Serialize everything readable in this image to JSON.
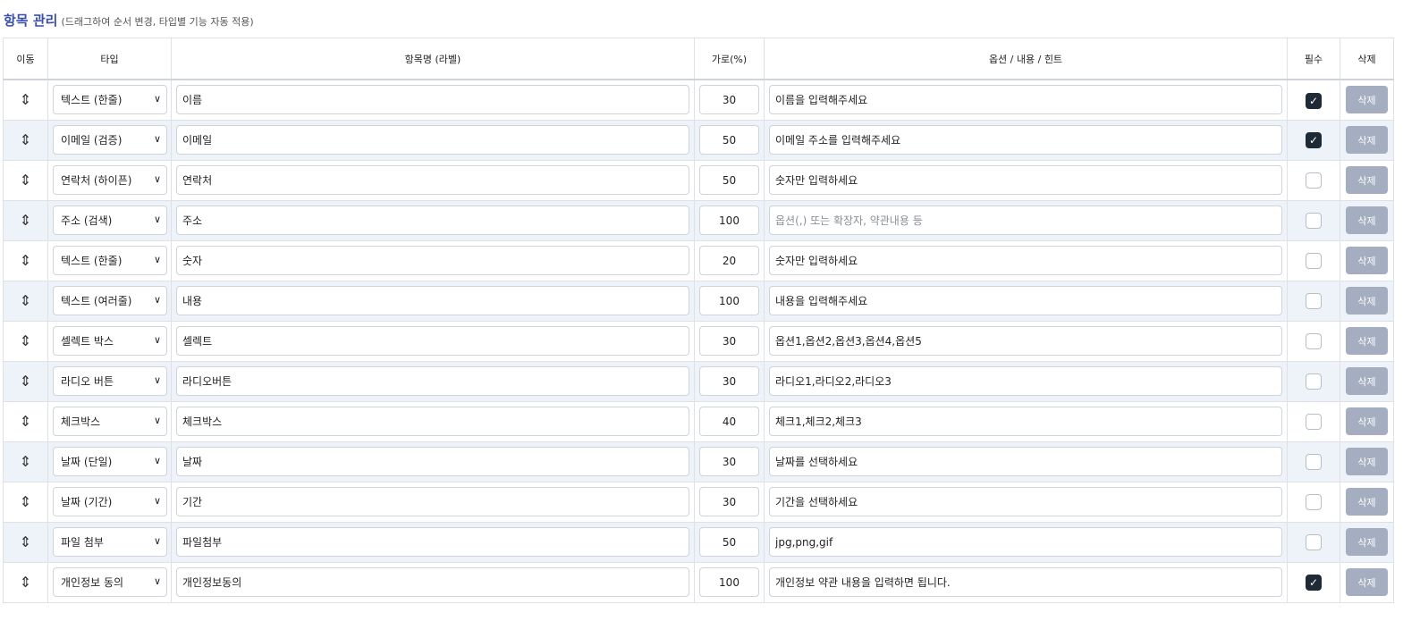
{
  "section": {
    "title": "항목 관리",
    "hint": "(드래그하여 순서 변경, 타입별 기능 자동 적용)"
  },
  "columns": {
    "move": "이동",
    "type": "타입",
    "label": "항목명 (라벨)",
    "width": "가로(%)",
    "options": "옵션 / 내용 / 힌트",
    "required": "필수",
    "delete": "삭제"
  },
  "icons": {
    "move": "up-down-arrow-icon",
    "select_chevron": "chevron-down-icon",
    "check": "checkmark-icon"
  },
  "options_placeholder": "옵션(,) 또는 확장자, 약관내용 등",
  "delete_label": "삭제",
  "rows": [
    {
      "type": "텍스트 (한줄)",
      "label": "이름",
      "width": "30",
      "options": "이름을 입력해주세요",
      "required": true
    },
    {
      "type": "이메일 (검증)",
      "label": "이메일",
      "width": "50",
      "options": "이메일 주소를 입력해주세요",
      "required": true
    },
    {
      "type": "연락처 (하이픈)",
      "label": "연락처",
      "width": "50",
      "options": "숫자만 입력하세요",
      "required": false
    },
    {
      "type": "주소 (검색)",
      "label": "주소",
      "width": "100",
      "options": "",
      "required": false
    },
    {
      "type": "텍스트 (한줄)",
      "label": "숫자",
      "width": "20",
      "options": "숫자만 입력하세요",
      "required": false
    },
    {
      "type": "텍스트 (여러줄)",
      "label": "내용",
      "width": "100",
      "options": "내용을 입력해주세요",
      "required": false
    },
    {
      "type": "셀렉트 박스",
      "label": "셀렉트",
      "width": "30",
      "options": "옵션1,옵션2,옵션3,옵션4,옵션5",
      "required": false
    },
    {
      "type": "라디오 버튼",
      "label": "라디오버튼",
      "width": "30",
      "options": "라디오1,라디오2,라디오3",
      "required": false
    },
    {
      "type": "체크박스",
      "label": "체크박스",
      "width": "40",
      "options": "체크1,체크2,체크3",
      "required": false
    },
    {
      "type": "날짜 (단일)",
      "label": "날짜",
      "width": "30",
      "options": "날짜를 선택하세요",
      "required": false
    },
    {
      "type": "날짜 (기간)",
      "label": "기간",
      "width": "30",
      "options": "기간을 선택하세요",
      "required": false
    },
    {
      "type": "파일 첨부",
      "label": "파일첨부",
      "width": "50",
      "options": "jpg,png,gif",
      "required": false
    },
    {
      "type": "개인정보 동의",
      "label": "개인정보동의",
      "width": "100",
      "options": "개인정보 약관 내용을 입력하면 됩니다.",
      "required": true
    }
  ]
}
